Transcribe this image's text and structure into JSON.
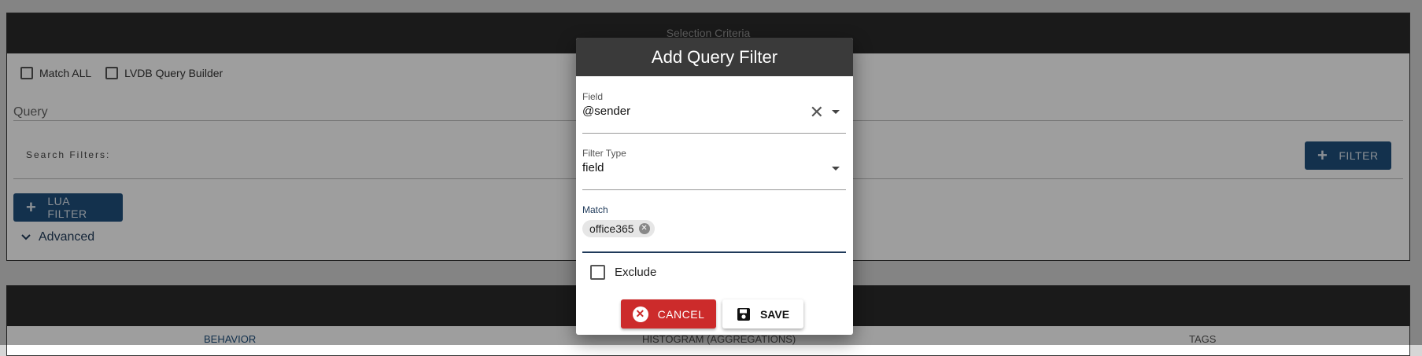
{
  "background": {
    "panel_title": "Selection Criteria",
    "checks": [
      {
        "label": "Match ALL"
      },
      {
        "label": "LVDB Query Builder"
      }
    ],
    "query_label": "Query",
    "search_filters_label": "Search Filters:",
    "filter_button": "FILTER",
    "lua_filter_button": "LUA FILTER",
    "advanced_label": "Advanced",
    "tabs": [
      "BEHAVIOR",
      "HISTOGRAM (AGGREGATIONS)",
      "TAGS"
    ]
  },
  "dialog": {
    "title": "Add Query Filter",
    "field": {
      "label": "Field",
      "value": "@sender"
    },
    "filter_type": {
      "label": "Filter Type",
      "value": "field"
    },
    "match": {
      "label": "Match",
      "chips": [
        "office365"
      ]
    },
    "exclude_label": "Exclude",
    "cancel_label": "CANCEL",
    "save_label": "SAVE"
  },
  "colors": {
    "header_dark": "#2a2a2a",
    "accent_blue": "#1f4f7d",
    "cancel_red": "#cc2b2b"
  }
}
